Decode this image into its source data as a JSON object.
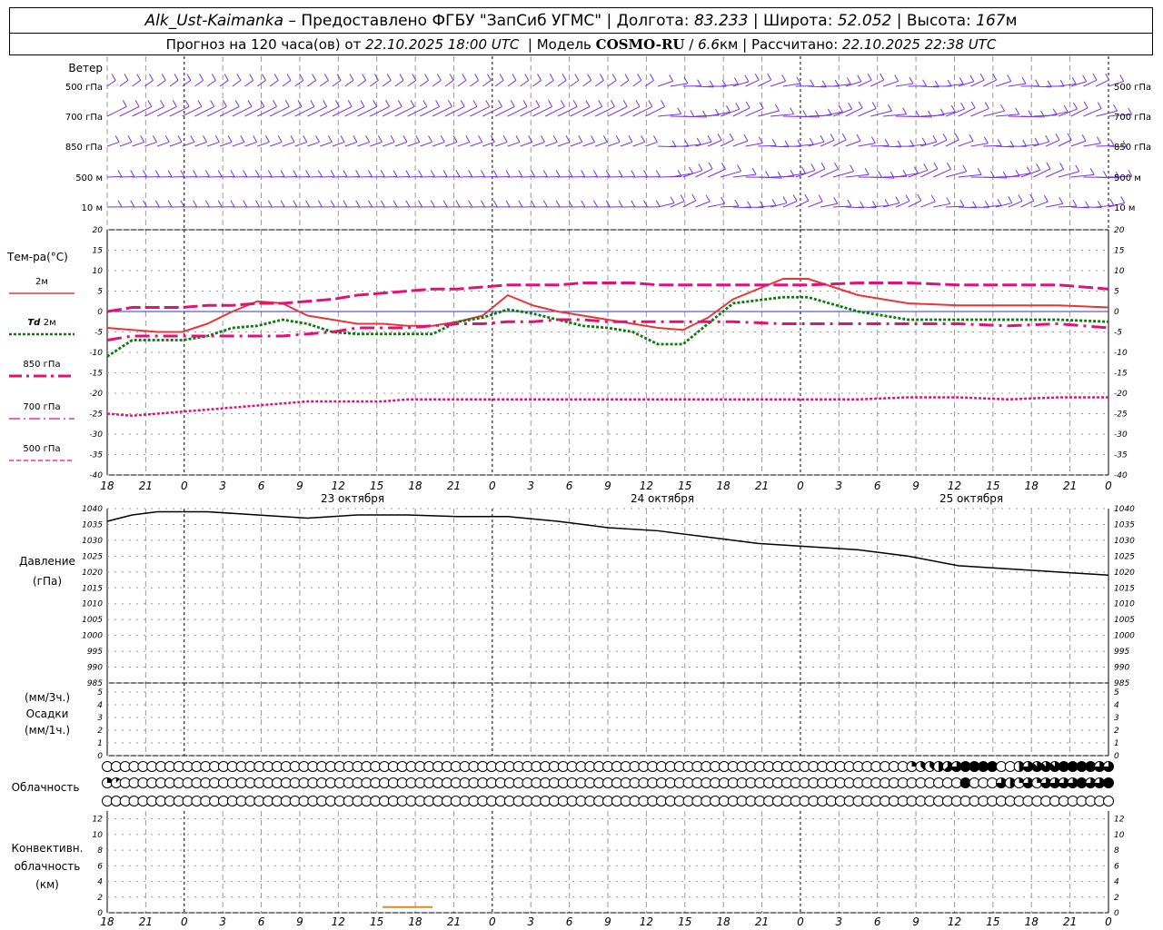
{
  "header": {
    "station": "Alk_Ust-Kaimanka",
    "dash": "–",
    "provider": "Предоставлено ФГБУ \"ЗапСиб УГМС\"",
    "lon_label": "Долгота:",
    "lon_value": "83.233",
    "lat_label": "Широта:",
    "lat_value": "52.052",
    "alt_label": "Высота:",
    "alt_value": "167",
    "alt_unit": "м",
    "forecast_label": "Прогноз на 120 часа(ов) от",
    "forecast_from": "22.10.2025 18:00 UTC",
    "model_label": "Модель",
    "model_name": "COSMO-RU",
    "model_res": "6.6",
    "model_res_unit": "км",
    "calc_label": "Рассчитано:",
    "calc_value": "22.10.2025 22:38 UTC"
  },
  "colors": {
    "wind": "#7a30e8",
    "t2m": "#ee3333",
    "td2m": "#0a7a0a",
    "t850": "#e0127a",
    "t700": "#e0127a",
    "t500": "#e0127a",
    "zero_line": "#3333cc",
    "grid": "#9a9a9a",
    "pressure": "#000000",
    "convective": "#e08a2a"
  },
  "x_ticks": [
    "18",
    "21",
    "0",
    "3",
    "6",
    "9",
    "12",
    "15",
    "18",
    "21",
    "0",
    "3",
    "6",
    "9",
    "12",
    "15",
    "18",
    "21",
    "0",
    "3",
    "6",
    "9",
    "12",
    "15",
    "18",
    "21",
    "0"
  ],
  "day_labels": [
    "23 октября",
    "24 октября",
    "25 октября"
  ],
  "wind_panel": {
    "title": "Ветер",
    "levels": [
      "500 гПа",
      "700 гПа",
      "850 гПа",
      "500 м",
      "10 м"
    ]
  },
  "temp_panel": {
    "title": "Тем-ра(°С)",
    "legend": [
      {
        "prefix": "",
        "label": "2м",
        "style": "solid",
        "color_key": "t2m"
      },
      {
        "prefix": "Td",
        "label": "2м",
        "style": "dotted",
        "color_key": "td2m"
      },
      {
        "prefix": "",
        "label": "850 гПа",
        "style": "dashdot",
        "color_key": "t850"
      },
      {
        "prefix": "",
        "label": "700 гПа",
        "style": "dashdot2",
        "color_key": "t700"
      },
      {
        "prefix": "",
        "label": "500 гПа",
        "style": "dash",
        "color_key": "t500"
      }
    ],
    "yticks": [
      "20",
      "15",
      "10",
      "5",
      "0",
      "-5",
      "-10",
      "-15",
      "-20",
      "-25",
      "-30",
      "-35",
      "-40"
    ]
  },
  "pressure_panel": {
    "title1": "Давление",
    "title2": "(гПа)",
    "yticks": [
      "1040",
      "1035",
      "1030",
      "1025",
      "1020",
      "1015",
      "1010",
      "1005",
      "1000",
      "995",
      "990",
      "985"
    ]
  },
  "precip_panel": {
    "label1": "(мм/3ч.)",
    "label2": "Осадки",
    "label3": "(мм/1ч.)",
    "yticks": [
      "5",
      "4",
      "3",
      "2",
      "1",
      "0"
    ]
  },
  "cloud_panel": {
    "title": "Облачность"
  },
  "conv_panel": {
    "label1": "Конвективн.",
    "label2": "облачность",
    "label3": "(км)",
    "yticks": [
      "12",
      "10",
      "8",
      "6",
      "4",
      "2",
      "0"
    ]
  },
  "chart_data": {
    "type": "line",
    "x_hours_from_start": [
      0,
      3,
      6,
      9,
      12,
      15,
      18,
      21,
      24,
      27,
      30,
      33,
      36,
      39,
      42,
      45,
      48,
      51,
      54,
      57,
      60,
      63,
      66,
      69,
      72,
      75,
      78
    ],
    "series": [
      {
        "name": "2м",
        "values": [
          -4,
          -4.5,
          -5,
          -5,
          -3,
          0,
          2.5,
          2,
          -1,
          -2,
          -3,
          -3,
          -3.5,
          -3.5,
          -2.5,
          -1,
          4,
          1.5,
          0,
          -1,
          -2,
          -3,
          -4,
          -4.5,
          -1.5,
          3,
          8,
          8,
          4,
          2,
          1.5,
          1.5,
          1.5,
          1
        ]
      },
      {
        "name": "Td 2м",
        "values": [
          -11,
          -7,
          -7,
          -7,
          -6,
          -4,
          -3.5,
          -2,
          -3,
          -5,
          -5.5,
          -5.5,
          -5.5,
          -5.5,
          -2.5,
          -1.5,
          0.5,
          -0.5,
          -2,
          -3.5,
          -4,
          -5,
          -8,
          -8,
          -3,
          2,
          3.5,
          3.5,
          0,
          -2,
          -2,
          -2,
          -2,
          -2.5
        ]
      },
      {
        "name": "850 гПа",
        "values": [
          -7,
          -6,
          -6,
          -6,
          -6,
          -6,
          -6,
          -6,
          -5.5,
          -5,
          -4,
          -4,
          -4,
          -3.5,
          -3,
          -3,
          -2.5,
          -2.5,
          -2,
          -2,
          -2.5,
          -2.5,
          -2.5,
          -2.5,
          -2.5,
          -2.5,
          -3,
          -3,
          -3,
          -3,
          -3,
          -3.5,
          -3,
          -4
        ]
      },
      {
        "name": "700 гПа",
        "values": [
          0,
          1,
          1,
          1,
          1.5,
          1.5,
          2,
          2,
          2.5,
          3,
          4,
          4.5,
          5,
          5.5,
          5.5,
          6,
          6.5,
          6.5,
          6.5,
          7,
          7,
          7,
          6.5,
          6.5,
          6.5,
          6.5,
          6.5,
          6.5,
          7,
          7,
          6.5,
          6.5,
          6.5,
          5.5
        ]
      },
      {
        "name": "500 гПа",
        "values": [
          -25,
          -25.5,
          -25,
          -24.5,
          -24,
          -23.5,
          -23,
          -22.5,
          -22,
          -22,
          -22,
          -22,
          -21.5,
          -21.5,
          -21.5,
          -21.5,
          -21.5,
          -21.5,
          -21.5,
          -21.5,
          -21.5,
          -21.5,
          -21.5,
          -21.5,
          -21.5,
          -21.5,
          -21.5,
          -21.5,
          -21.5,
          -21,
          -21,
          -21.5,
          -21,
          -21
        ]
      }
    ],
    "series_x_hours": [
      0,
      3,
      6,
      9,
      12,
      15,
      18,
      21,
      24,
      27,
      30,
      33,
      36,
      39,
      42,
      45,
      48,
      51,
      54,
      57,
      60,
      63,
      66,
      69,
      72,
      75,
      81,
      84,
      90,
      96,
      102,
      108,
      114,
      120
    ],
    "pressure": {
      "x_hours": [
        0,
        3,
        6,
        12,
        18,
        24,
        30,
        36,
        42,
        48,
        54,
        60,
        66,
        72,
        78,
        84,
        90,
        96,
        102,
        108,
        114,
        120
      ],
      "values": [
        1036,
        1038,
        1039,
        1039,
        1038,
        1037,
        1038,
        1038,
        1037.5,
        1037.5,
        1036,
        1034,
        1033,
        1031,
        1029,
        1028,
        1027,
        1025,
        1022,
        1021,
        1020,
        1019
      ]
    },
    "precipitation": [],
    "convective_cloud": {
      "from_hour": 33,
      "to_hour": 39,
      "value_km": 0.5
    },
    "cloud_rows": {
      "levels": [
        "upper",
        "middle",
        "lower"
      ],
      "cover_oktas": [
        [
          0,
          0,
          0,
          0,
          0,
          0,
          0,
          0,
          0,
          0,
          0,
          0,
          0,
          0,
          0,
          0,
          0,
          0,
          0,
          0,
          0,
          0,
          0,
          0,
          0,
          0,
          0,
          0,
          0,
          0,
          0,
          0,
          0,
          0,
          0,
          0,
          0,
          0,
          0,
          0,
          0,
          0,
          0,
          0,
          0,
          0,
          0,
          0,
          0,
          0,
          0,
          0,
          0,
          0,
          0,
          0,
          0,
          0,
          0,
          0,
          0,
          0,
          0,
          0,
          0,
          0,
          0,
          0,
          0,
          0,
          0,
          0,
          0,
          0,
          0,
          0,
          0,
          0,
          0,
          0,
          0,
          0,
          0,
          0,
          0,
          0,
          0,
          0,
          0,
          0,
          2,
          3,
          3,
          4,
          5,
          6,
          8,
          8,
          8,
          8,
          0,
          0,
          4,
          6,
          7,
          7,
          7,
          8,
          8,
          8,
          8,
          6,
          6
        ],
        [
          2,
          1,
          0,
          0,
          0,
          0,
          0,
          0,
          0,
          0,
          0,
          0,
          0,
          0,
          0,
          0,
          0,
          0,
          0,
          0,
          0,
          0,
          0,
          0,
          0,
          0,
          0,
          0,
          0,
          0,
          0,
          0,
          0,
          0,
          0,
          0,
          0,
          0,
          0,
          0,
          0,
          0,
          0,
          0,
          0,
          0,
          0,
          0,
          0,
          0,
          0,
          0,
          0,
          0,
          0,
          0,
          0,
          0,
          0,
          0,
          0,
          0,
          0,
          0,
          0,
          0,
          0,
          0,
          0,
          0,
          0,
          0,
          0,
          0,
          0,
          0,
          0,
          0,
          0,
          0,
          0,
          0,
          0,
          0,
          0,
          0,
          0,
          0,
          0,
          0,
          0,
          0,
          0,
          0,
          0,
          0,
          8,
          0,
          0,
          0,
          6,
          4,
          2,
          6,
          2,
          6,
          6,
          6,
          6,
          8,
          6,
          6,
          8,
          8
        ],
        [
          0,
          0,
          0,
          0,
          0,
          0,
          0,
          0,
          0,
          0,
          0,
          0,
          0,
          0,
          0,
          0,
          0,
          0,
          0,
          0,
          0,
          0,
          0,
          0,
          0,
          0,
          0,
          0,
          0,
          0,
          0,
          0,
          0,
          0,
          0,
          0,
          0,
          0,
          0,
          0,
          0,
          0,
          0,
          0,
          0,
          0,
          0,
          0,
          0,
          0,
          0,
          0,
          0,
          0,
          0,
          0,
          0,
          0,
          0,
          0,
          0,
          0,
          0,
          0,
          0,
          0,
          0,
          0,
          0,
          0,
          0,
          0,
          0,
          0,
          0,
          0,
          0,
          0,
          0,
          0,
          0,
          0,
          0,
          0,
          0,
          0,
          0,
          0,
          0,
          0,
          0,
          0,
          0,
          0,
          0,
          0,
          0,
          0,
          0,
          0,
          0,
          0,
          0,
          0,
          0,
          0,
          0,
          0,
          0,
          0,
          0,
          0,
          0,
          0
        ]
      ]
    },
    "ylim_temp": [
      -40,
      20
    ],
    "ylim_pressure": [
      985,
      1040
    ],
    "ylim_precip": [
      0,
      5
    ],
    "ylim_conv": [
      0,
      13
    ]
  }
}
